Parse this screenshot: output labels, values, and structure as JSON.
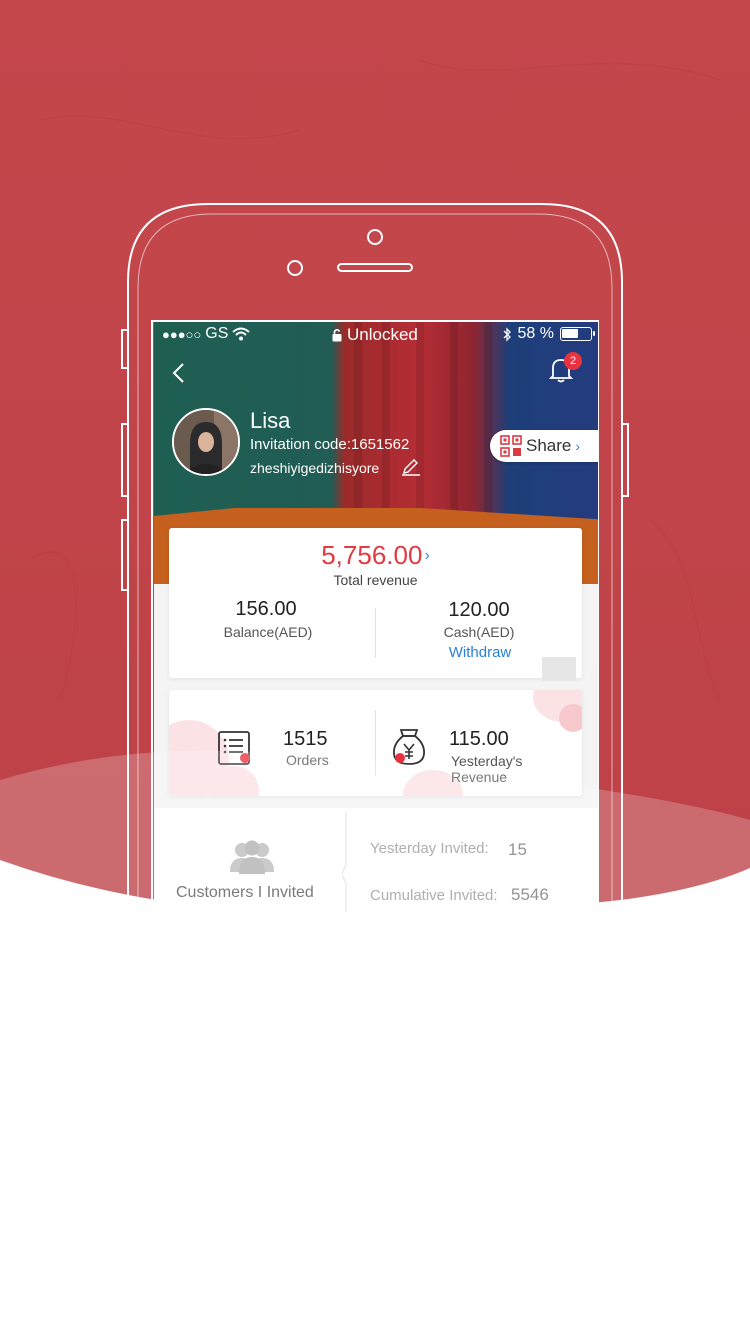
{
  "colors": {
    "background_red": "#c0454a",
    "accent_red": "#e23a42",
    "link_blue": "#2a7fd8",
    "badge_red": "#e8323f"
  },
  "status_bar": {
    "carrier": "GS",
    "lock_text": "Unlocked",
    "battery_text": "58 %",
    "battery_level": 0.58
  },
  "header": {
    "notification_count": "2",
    "share_label": "Share"
  },
  "profile": {
    "name": "Lisa",
    "invitation_code": "Invitation code:1651562",
    "handle": "zheshiyigedizhisyore"
  },
  "revenue": {
    "total_value": "5,756.00",
    "total_label": "Total revenue",
    "balance_value": "156.00",
    "balance_label": "Balance(AED)",
    "cash_value": "120.00",
    "cash_label": "Cash(AED)",
    "withdraw_label": "Withdraw"
  },
  "stats": {
    "orders_value": "1515",
    "orders_label": "Orders",
    "yesterday_revenue_value": "115.00",
    "yesterday_revenue_label": "Yesterday's Revenue"
  },
  "customers": {
    "label": "Customers I Invited",
    "yesterday_invited_label": "Yesterday Invited:",
    "yesterday_invited_value": "15",
    "cumulative_invited_label": "Cumulative Invited:",
    "cumulative_invited_value": "5546"
  },
  "icons": [
    "back-icon",
    "bell-icon",
    "qr-code-icon",
    "edit-icon",
    "orders-list-icon",
    "money-bag-icon",
    "users-icon",
    "wifi-icon",
    "lock-icon",
    "bluetooth-icon",
    "battery-icon"
  ]
}
